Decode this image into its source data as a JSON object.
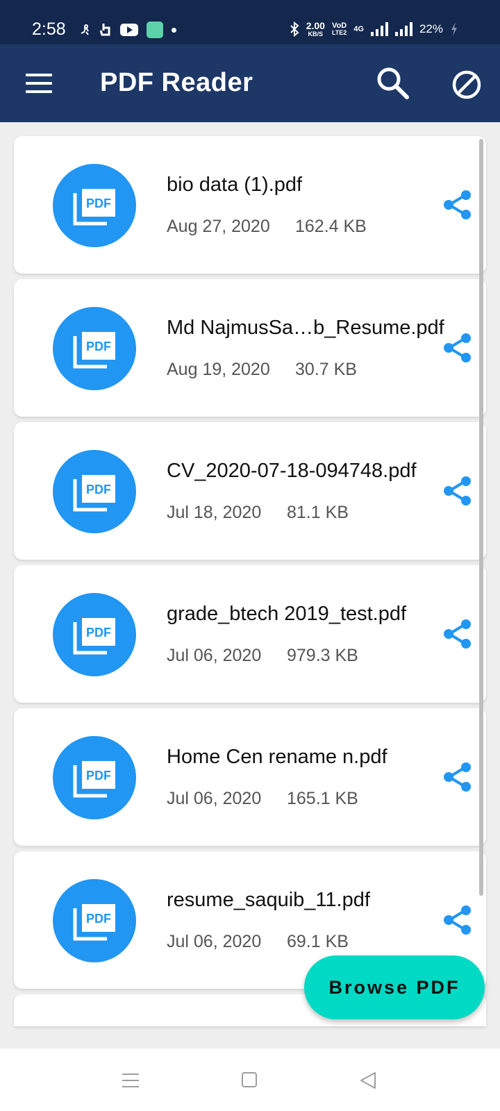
{
  "status_bar": {
    "time": "2:58",
    "net_speed_value": "2.00",
    "net_speed_unit": "KB/S",
    "volte_top": "VoD",
    "volte_bottom": "LTE2",
    "network_type": "4G",
    "battery": "22%"
  },
  "app_bar": {
    "title": "PDF Reader",
    "menu_icon": "hamburger-menu-icon",
    "search_icon": "search-icon",
    "block_icon": "block-icon"
  },
  "files": [
    {
      "name": "bio data (1).pdf",
      "date": "Aug 27, 2020",
      "size": "162.4 KB",
      "icon_label": "PDF"
    },
    {
      "name": "Md NajmusSa…b_Resume.pdf",
      "date": "Aug 19, 2020",
      "size": "30.7 KB",
      "icon_label": "PDF"
    },
    {
      "name": "CV_2020-07-18-094748.pdf",
      "date": "Jul 18, 2020",
      "size": "81.1 KB",
      "icon_label": "PDF"
    },
    {
      "name": "grade_btech 2019_test.pdf",
      "date": "Jul 06, 2020",
      "size": "979.3 KB",
      "icon_label": "PDF"
    },
    {
      "name": "Home Cen rename n.pdf",
      "date": "Jul 06, 2020",
      "size": "165.1 KB",
      "icon_label": "PDF"
    },
    {
      "name": "resume_saquib_11.pdf",
      "date": "Jul 06, 2020",
      "size": "69.1 KB",
      "icon_label": "PDF"
    }
  ],
  "fab": {
    "label": "Browse PDF"
  },
  "colors": {
    "status_bar": "#14284e",
    "app_bar": "#1d3766",
    "pdf_badge": "#2196f3",
    "share_icon": "#2196f3",
    "fab": "#00d9c3"
  }
}
